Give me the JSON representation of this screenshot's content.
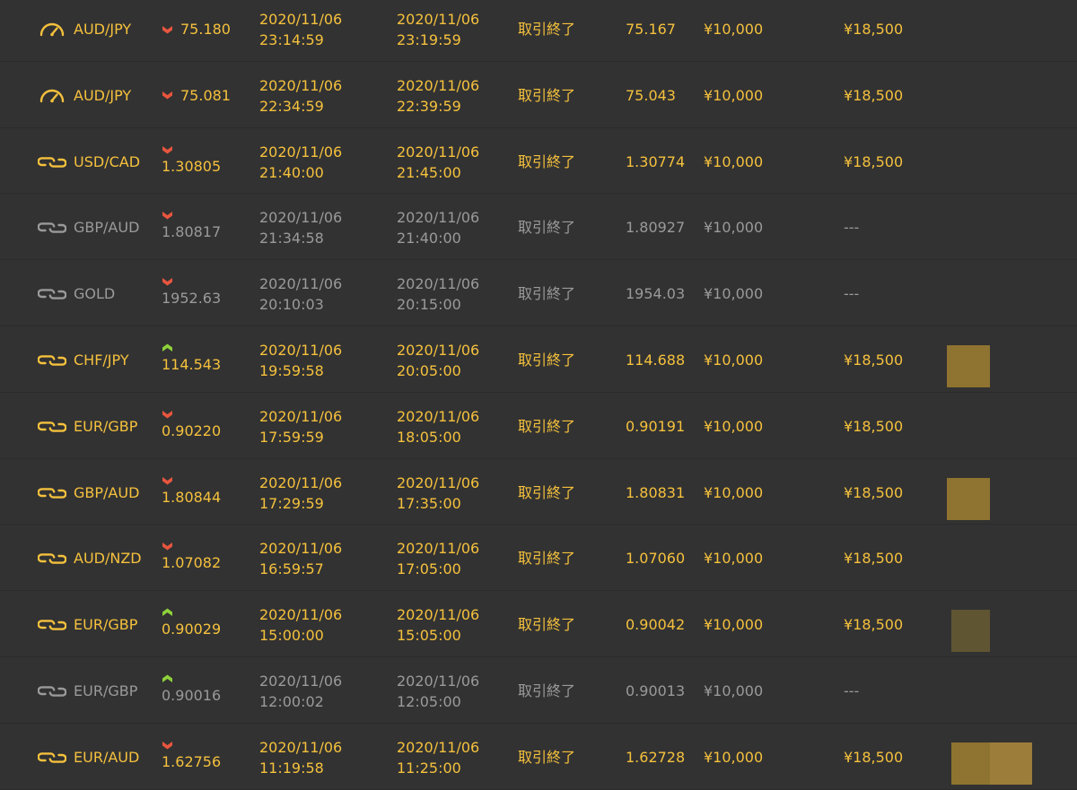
{
  "colors": {
    "background": "#323232",
    "win_text": "#f5c13d",
    "loss_text": "#9a9a9a",
    "arrow_down": "#e8553e",
    "arrow_up": "#8ed13a",
    "swatch_gold": "#8f7330",
    "swatch_dark": "#5f5532"
  },
  "trades": [
    {
      "icon": "speedometer-icon",
      "result": "win",
      "pair": "AUD/JPY",
      "direction": "down",
      "rate": "75.180",
      "rate_layout": "inline",
      "start_date": "2020/11/06",
      "start_time": "23:14:59",
      "end_date": "2020/11/06",
      "end_time": "23:19:59",
      "status": "取引終了",
      "close_rate": "75.167",
      "amount": "¥10,000",
      "payout": "¥18,500"
    },
    {
      "icon": "speedometer-icon",
      "result": "win",
      "pair": "AUD/JPY",
      "direction": "down",
      "rate": "75.081",
      "rate_layout": "inline",
      "start_date": "2020/11/06",
      "start_time": "22:34:59",
      "end_date": "2020/11/06",
      "end_time": "22:39:59",
      "status": "取引終了",
      "close_rate": "75.043",
      "amount": "¥10,000",
      "payout": "¥18,500"
    },
    {
      "icon": "exchange-icon",
      "result": "win",
      "pair": "USD/CAD",
      "direction": "down",
      "rate": "1.30805",
      "rate_layout": "stack",
      "start_date": "2020/11/06",
      "start_time": "21:40:00",
      "end_date": "2020/11/06",
      "end_time": "21:45:00",
      "status": "取引終了",
      "close_rate": "1.30774",
      "amount": "¥10,000",
      "payout": "¥18,500"
    },
    {
      "icon": "exchange-icon",
      "result": "loss",
      "pair": "GBP/AUD",
      "direction": "down",
      "rate": "1.80817",
      "rate_layout": "stack",
      "start_date": "2020/11/06",
      "start_time": "21:34:58",
      "end_date": "2020/11/06",
      "end_time": "21:40:00",
      "status": "取引終了",
      "close_rate": "1.80927",
      "amount": "¥10,000",
      "payout": "---"
    },
    {
      "icon": "exchange-icon",
      "result": "loss",
      "pair": "GOLD",
      "direction": "down",
      "rate": "1952.63",
      "rate_layout": "stack",
      "start_date": "2020/11/06",
      "start_time": "20:10:03",
      "end_date": "2020/11/06",
      "end_time": "20:15:00",
      "status": "取引終了",
      "close_rate": "1954.03",
      "amount": "¥10,000",
      "payout": "---"
    },
    {
      "icon": "exchange-icon",
      "result": "win",
      "pair": "CHF/JPY",
      "direction": "up",
      "rate": "114.543",
      "rate_layout": "stack",
      "start_date": "2020/11/06",
      "start_time": "19:59:58",
      "end_date": "2020/11/06",
      "end_time": "20:05:00",
      "status": "取引終了",
      "close_rate": "114.688",
      "amount": "¥10,000",
      "payout": "¥18,500"
    },
    {
      "icon": "exchange-icon",
      "result": "win",
      "pair": "EUR/GBP",
      "direction": "down",
      "rate": "0.90220",
      "rate_layout": "stack",
      "start_date": "2020/11/06",
      "start_time": "17:59:59",
      "end_date": "2020/11/06",
      "end_time": "18:05:00",
      "status": "取引終了",
      "close_rate": "0.90191",
      "amount": "¥10,000",
      "payout": "¥18,500"
    },
    {
      "icon": "exchange-icon",
      "result": "win",
      "pair": "GBP/AUD",
      "direction": "down",
      "rate": "1.80844",
      "rate_layout": "stack",
      "start_date": "2020/11/06",
      "start_time": "17:29:59",
      "end_date": "2020/11/06",
      "end_time": "17:35:00",
      "status": "取引終了",
      "close_rate": "1.80831",
      "amount": "¥10,000",
      "payout": "¥18,500"
    },
    {
      "icon": "exchange-icon",
      "result": "win",
      "pair": "AUD/NZD",
      "direction": "down",
      "rate": "1.07082",
      "rate_layout": "stack",
      "start_date": "2020/11/06",
      "start_time": "16:59:57",
      "end_date": "2020/11/06",
      "end_time": "17:05:00",
      "status": "取引終了",
      "close_rate": "1.07060",
      "amount": "¥10,000",
      "payout": "¥18,500"
    },
    {
      "icon": "exchange-icon",
      "result": "win",
      "pair": "EUR/GBP",
      "direction": "up",
      "rate": "0.90029",
      "rate_layout": "stack",
      "start_date": "2020/11/06",
      "start_time": "15:00:00",
      "end_date": "2020/11/06",
      "end_time": "15:05:00",
      "status": "取引終了",
      "close_rate": "0.90042",
      "amount": "¥10,000",
      "payout": "¥18,500"
    },
    {
      "icon": "exchange-icon",
      "result": "loss",
      "pair": "EUR/GBP",
      "direction": "up",
      "rate": "0.90016",
      "rate_layout": "stack",
      "start_date": "2020/11/06",
      "start_time": "12:00:02",
      "end_date": "2020/11/06",
      "end_time": "12:05:00",
      "status": "取引終了",
      "close_rate": "0.90013",
      "amount": "¥10,000",
      "payout": "---"
    },
    {
      "icon": "exchange-icon",
      "result": "win",
      "pair": "EUR/AUD",
      "direction": "down",
      "rate": "1.62756",
      "rate_layout": "stack",
      "start_date": "2020/11/06",
      "start_time": "11:19:58",
      "end_date": "2020/11/06",
      "end_time": "11:25:00",
      "status": "取引終了",
      "close_rate": "1.62728",
      "amount": "¥10,000",
      "payout": "¥18,500"
    }
  ]
}
